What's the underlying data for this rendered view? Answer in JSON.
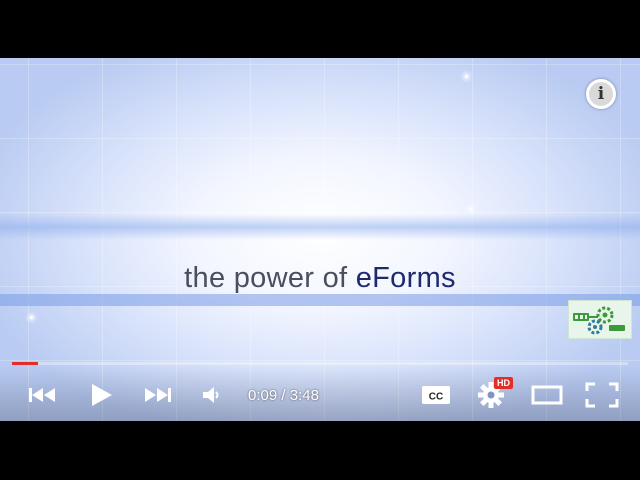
{
  "video": {
    "tagline_prefix": "the power of ",
    "tagline_brand": "eForms",
    "colors": {
      "tagline_text": "#4a4f5e",
      "brand_text": "#1f2a6e",
      "background_glow": "#b9cbf2"
    }
  },
  "overlay": {
    "info_label": "i",
    "info_icon": "info-icon",
    "logo_icon": "gears-logo-icon"
  },
  "player": {
    "progress_fraction": 0.043,
    "progress_color": "#e52d27",
    "time_current": "0:09",
    "time_separator": " / ",
    "time_total": "3:48",
    "hd_badge": "HD",
    "cc_label": "CC",
    "icons": {
      "previous": "skip-previous-icon",
      "play": "play-icon",
      "next": "skip-next-icon",
      "volume": "volume-icon",
      "captions": "captions-icon",
      "settings": "gear-icon",
      "theater": "theater-mode-icon",
      "fullscreen": "fullscreen-icon"
    }
  }
}
